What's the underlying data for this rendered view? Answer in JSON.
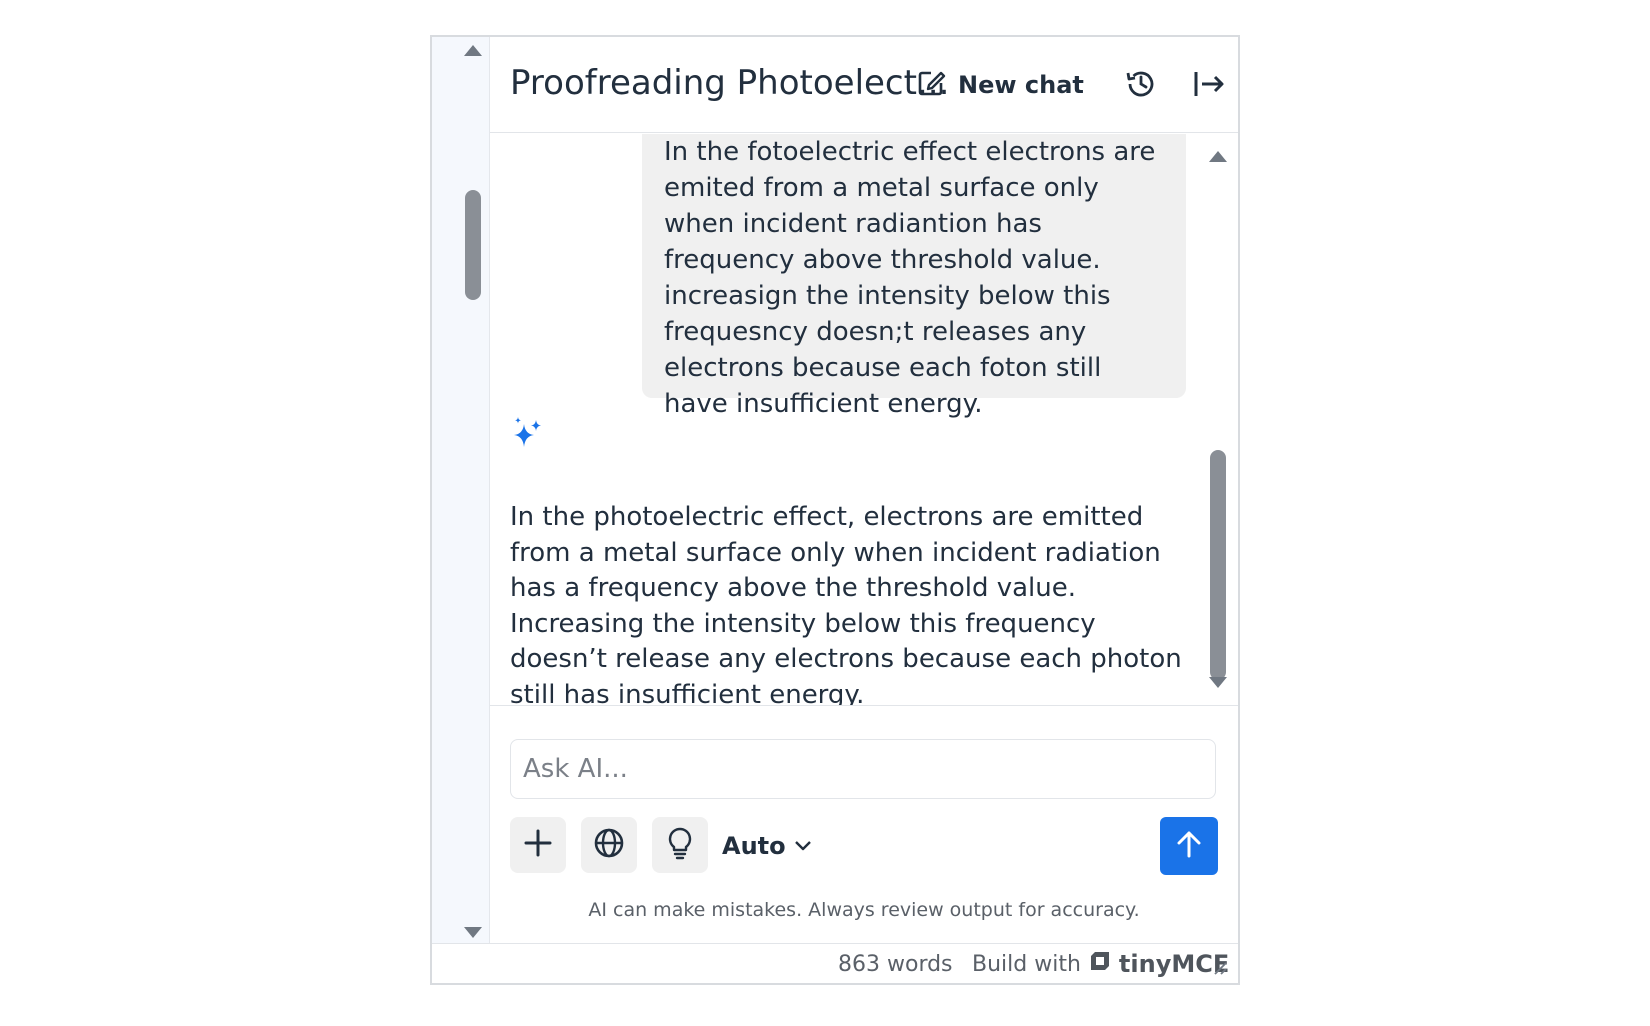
{
  "header": {
    "title": "Proofreading Photoelect...",
    "new_chat_label": "New chat",
    "icons": {
      "new_chat": "edit-square-icon",
      "history": "history-icon",
      "close": "collapse-panel-icon"
    }
  },
  "messages": {
    "user_message": "In the fotoelectric effect electrons are emited from a metal surface only when incident radiantion has frequency above threshold value. increasign the intensity below this frequesncy doesn;t releases any electrons because each foton still have insufficient energy.",
    "ai_icon": "sparkles-icon",
    "ai_message": "In the photoelectric effect, electrons are emitted from a metal surface only when incident radiation has a frequency above the threshold value. Increasing the intensity below this frequency doesn’t release any electrons because each photon still has insufficient energy."
  },
  "composer": {
    "input_placeholder": "Ask AI...",
    "input_value": "",
    "model_select": "Auto",
    "disclaimer": "AI can make mistakes. Always review output for accuracy.",
    "tools": [
      "plus-icon",
      "globe-icon",
      "lightbulb-icon"
    ],
    "send_icon": "arrow-up-icon"
  },
  "status_bar": {
    "word_count": "863 words",
    "build_with": "Build with",
    "brand": "tinyMCE"
  },
  "colors": {
    "accent": "#1a73e8",
    "sparkle": "#1a73e8",
    "bubble": "#f0f0f0",
    "text": "#222f3e"
  }
}
